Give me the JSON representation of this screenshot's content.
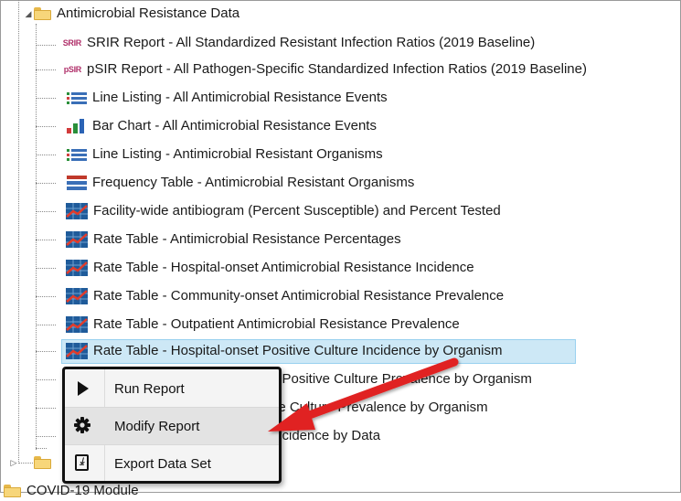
{
  "tree": {
    "group": {
      "label": "Antimicrobial Resistance Data",
      "expanded_glyph": "◢"
    },
    "items": [
      {
        "icon": "srir-icon",
        "badge": "SRIR",
        "label": "SRIR Report - All Standardized Resistant Infection Ratios (2019 Baseline)"
      },
      {
        "icon": "psir-icon",
        "badge": "pSIR",
        "label": "pSIR Report - All Pathogen-Specific Standardized Infection Ratios (2019 Baseline)"
      },
      {
        "icon": "line-listing-icon",
        "label": "Line Listing - All Antimicrobial Resistance Events"
      },
      {
        "icon": "bar-chart-icon",
        "label": "Bar Chart - All Antimicrobial Resistance Events"
      },
      {
        "icon": "line-listing-icon",
        "label": "Line Listing - Antimicrobial Resistant Organisms"
      },
      {
        "icon": "frequency-table-icon",
        "label": "Frequency Table - Antimicrobial Resistant Organisms"
      },
      {
        "icon": "rate-table-icon",
        "label": "Facility-wide antibiogram (Percent Susceptible) and Percent Tested"
      },
      {
        "icon": "rate-table-icon",
        "label": "Rate Table - Antimicrobial Resistance Percentages"
      },
      {
        "icon": "rate-table-icon",
        "label": "Rate Table - Hospital-onset Antimicrobial Resistance Incidence"
      },
      {
        "icon": "rate-table-icon",
        "label": "Rate Table - Community-onset Antimicrobial Resistance Prevalence"
      },
      {
        "icon": "rate-table-icon",
        "label": "Rate Table - Outpatient Antimicrobial Resistance Prevalence"
      },
      {
        "icon": "rate-table-icon",
        "label": "Rate Table - Hospital-onset Positive Culture Incidence by Organism",
        "selected": true
      },
      {
        "icon": "rate-table-icon",
        "label": "Rate Table - Community-onset Positive Culture Prevalence by Organism"
      },
      {
        "icon": "rate-table-icon",
        "label": "Rate Table - Outpatient Positive Culture Prevalence by Organism"
      },
      {
        "icon": "rate-table-icon",
        "label": "Rate Table - Positive Culture Incidence by Data"
      }
    ],
    "next_group": {
      "label": "COVID-19 Module"
    },
    "collapsed_glyph": "▷"
  },
  "context_menu": {
    "items": [
      {
        "icon": "play-icon",
        "label": "Run Report"
      },
      {
        "icon": "gear-icon",
        "label": "Modify Report",
        "hovered": true
      },
      {
        "icon": "export-icon",
        "label": "Export Data Set",
        "glyph": "⤓"
      }
    ]
  },
  "annotation": {
    "arrow_color": "#e02020"
  },
  "colors": {
    "selection": "#cde8f6",
    "folder": "#f7d67a",
    "badge": "#b0306a"
  }
}
